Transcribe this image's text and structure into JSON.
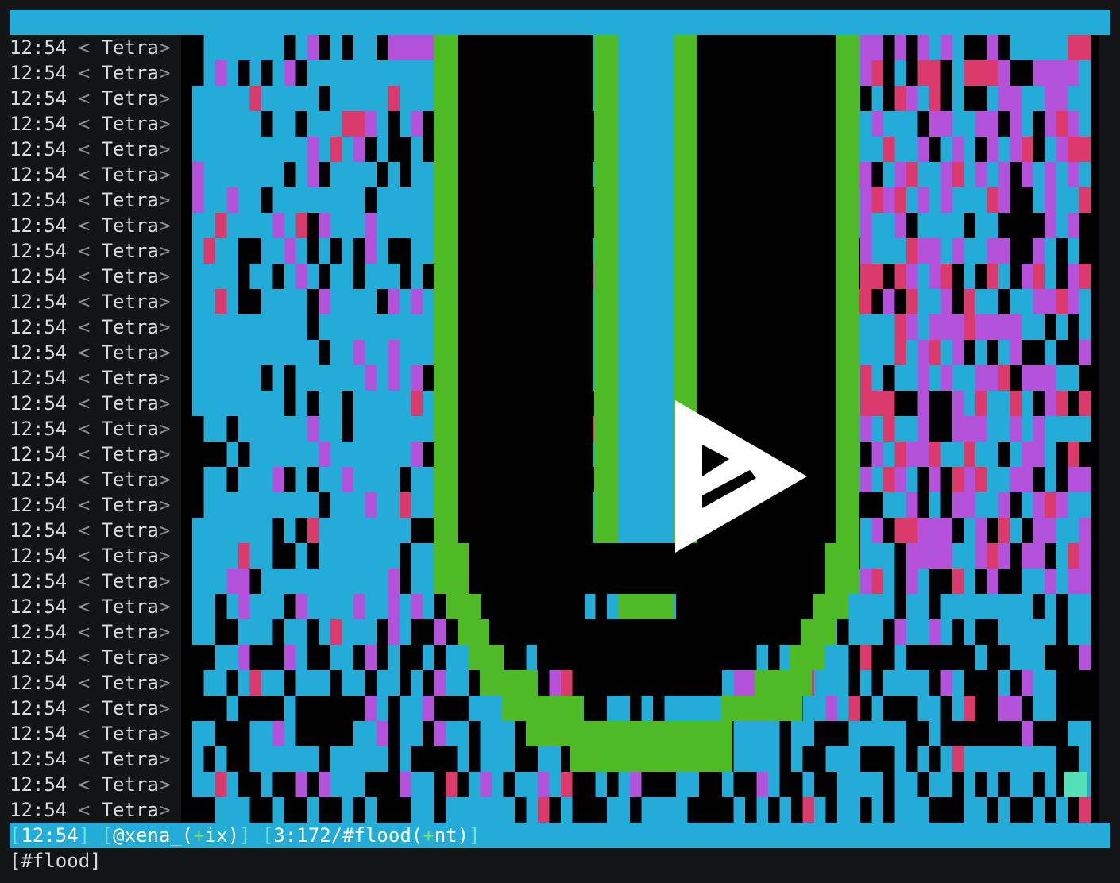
{
  "topic": "",
  "colors": {
    "cyan": "#24acd8",
    "magenta": "#b452dc",
    "red": "#dc3a6c",
    "green": "#4dba26",
    "teal": "#56e0b8",
    "black": "#000000"
  },
  "chat": {
    "lines": [
      {
        "time": "12:54",
        "nick": "Tetra"
      },
      {
        "time": "12:54",
        "nick": "Tetra"
      },
      {
        "time": "12:54",
        "nick": "Tetra"
      },
      {
        "time": "12:54",
        "nick": "Tetra"
      },
      {
        "time": "12:54",
        "nick": "Tetra"
      },
      {
        "time": "12:54",
        "nick": "Tetra"
      },
      {
        "time": "12:54",
        "nick": "Tetra"
      },
      {
        "time": "12:54",
        "nick": "Tetra"
      },
      {
        "time": "12:54",
        "nick": "Tetra"
      },
      {
        "time": "12:54",
        "nick": "Tetra"
      },
      {
        "time": "12:54",
        "nick": "Tetra"
      },
      {
        "time": "12:54",
        "nick": "Tetra"
      },
      {
        "time": "12:54",
        "nick": "Tetra"
      },
      {
        "time": "12:54",
        "nick": "Tetra"
      },
      {
        "time": "12:54",
        "nick": "Tetra"
      },
      {
        "time": "12:54",
        "nick": "Tetra"
      },
      {
        "time": "12:54",
        "nick": "Tetra"
      },
      {
        "time": "12:54",
        "nick": "Tetra"
      },
      {
        "time": "12:54",
        "nick": "Tetra"
      },
      {
        "time": "12:54",
        "nick": "Tetra"
      },
      {
        "time": "12:54",
        "nick": "Tetra"
      },
      {
        "time": "12:54",
        "nick": "Tetra"
      },
      {
        "time": "12:54",
        "nick": "Tetra"
      },
      {
        "time": "12:54",
        "nick": "Tetra"
      },
      {
        "time": "12:54",
        "nick": "Tetra"
      },
      {
        "time": "12:54",
        "nick": "Tetra"
      },
      {
        "time": "12:54",
        "nick": "Tetra"
      },
      {
        "time": "12:54",
        "nick": "Tetra"
      },
      {
        "time": "12:54",
        "nick": "Tetra"
      },
      {
        "time": "12:54",
        "nick": "Tetra"
      },
      {
        "time": "12:54",
        "nick": "Tetra"
      }
    ]
  },
  "art": {
    "logo_icon": "asciinema-play-icon"
  },
  "status": {
    "time": "12:54",
    "user": "@xena_",
    "user_mode_prefix": "+",
    "user_mode": "ix",
    "window": "3:172/#flood",
    "channel_mode_prefix": "+",
    "channel_mode": "nt"
  },
  "input": {
    "prompt": "[#flood]"
  }
}
